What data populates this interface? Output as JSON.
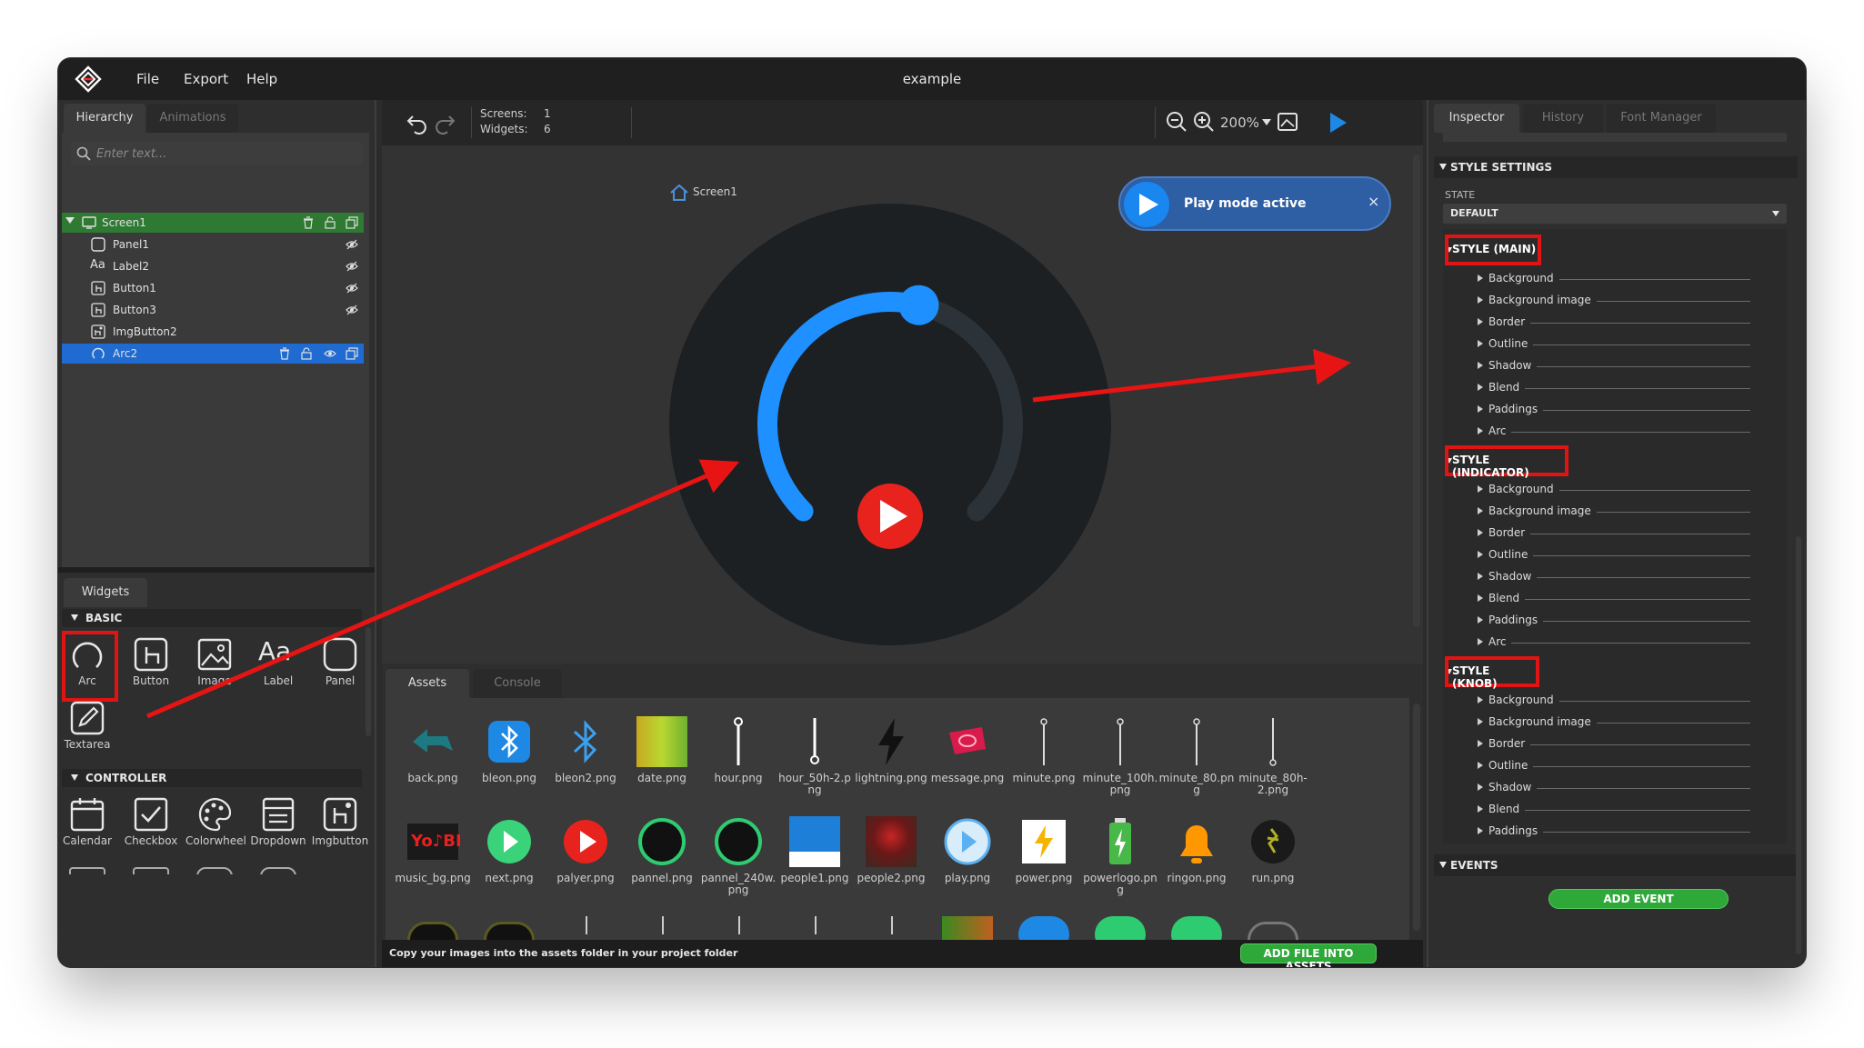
{
  "menubar": {
    "items": [
      "File",
      "Export",
      "Help"
    ],
    "title": "example"
  },
  "left_panel": {
    "tabs": [
      "Hierarchy",
      "Animations"
    ],
    "search_placeholder": "Enter text...",
    "tree": [
      {
        "label": "Screen1",
        "icon": "screen-icon",
        "state": "selected-green"
      },
      {
        "label": "Panel1",
        "icon": "panel-icon"
      },
      {
        "label": "Label2",
        "icon": "label-icon"
      },
      {
        "label": "Button1",
        "icon": "button-icon"
      },
      {
        "label": "Button3",
        "icon": "button-icon"
      },
      {
        "label": "ImgButton2",
        "icon": "imgbutton-icon"
      },
      {
        "label": "Arc2",
        "icon": "arc-icon",
        "state": "selected-blue"
      }
    ],
    "widgets_tab": "Widgets",
    "sections": [
      {
        "title": "BASIC",
        "items": [
          "Arc",
          "Button",
          "Image",
          "Label",
          "Panel",
          "Textarea"
        ]
      },
      {
        "title": "CONTROLLER",
        "items": [
          "Calendar",
          "Checkbox",
          "Colorwheel",
          "Dropdown",
          "Imgbutton"
        ]
      }
    ]
  },
  "toolbar": {
    "screens_label": "Screens:",
    "screens_value": "1",
    "widgets_label": "Widgets:",
    "widgets_value": "6",
    "zoom": "200%",
    "play_banner": "Play mode active",
    "close_glyph": "×"
  },
  "canvas": {
    "screen_label": "Screen1",
    "arc_value": 0.55,
    "colors": {
      "arc": "#1e90ff",
      "track": "#2c3338",
      "screen": "#1c2023",
      "play": "#e8231d"
    }
  },
  "bottom_panel": {
    "tabs": [
      "Assets",
      "Console"
    ],
    "assets_row1": [
      "back.png",
      "bleon.png",
      "bleon2.png",
      "date.png",
      "hour.png",
      "hour_50h-2.png",
      "lightning.png",
      "message.png",
      "minute.png",
      "minute_100h.png",
      "minute_80.png",
      "minute_80h-2.png"
    ],
    "assets_row2": [
      "music_bg.png",
      "next.png",
      "palyer.png",
      "pannel.png",
      "pannel_240w.png",
      "people1.png",
      "people2.png",
      "play.png",
      "power.png",
      "powerlogo.png",
      "ringon.png",
      "run.png"
    ],
    "hint": "Copy your images into the assets folder in your project folder",
    "add_button": "ADD FILE INTO ASSETS"
  },
  "inspector": {
    "tabs": [
      "Inspector",
      "History",
      "Font Manager"
    ],
    "style_settings": "STYLE SETTINGS",
    "state_label": "STATE",
    "state_value": "DEFAULT",
    "groups": [
      {
        "title": "STYLE (MAIN)",
        "props": [
          "Background",
          "Background image",
          "Border",
          "Outline",
          "Shadow",
          "Blend",
          "Paddings",
          "Arc"
        ]
      },
      {
        "title": "STYLE (INDICATOR)",
        "props": [
          "Background",
          "Background image",
          "Border",
          "Outline",
          "Shadow",
          "Blend",
          "Paddings",
          "Arc"
        ]
      },
      {
        "title": "STYLE (KNOB)",
        "props": [
          "Background",
          "Background image",
          "Border",
          "Outline",
          "Shadow",
          "Blend",
          "Paddings"
        ]
      }
    ],
    "events": "EVENTS",
    "add_event": "ADD EVENT"
  }
}
